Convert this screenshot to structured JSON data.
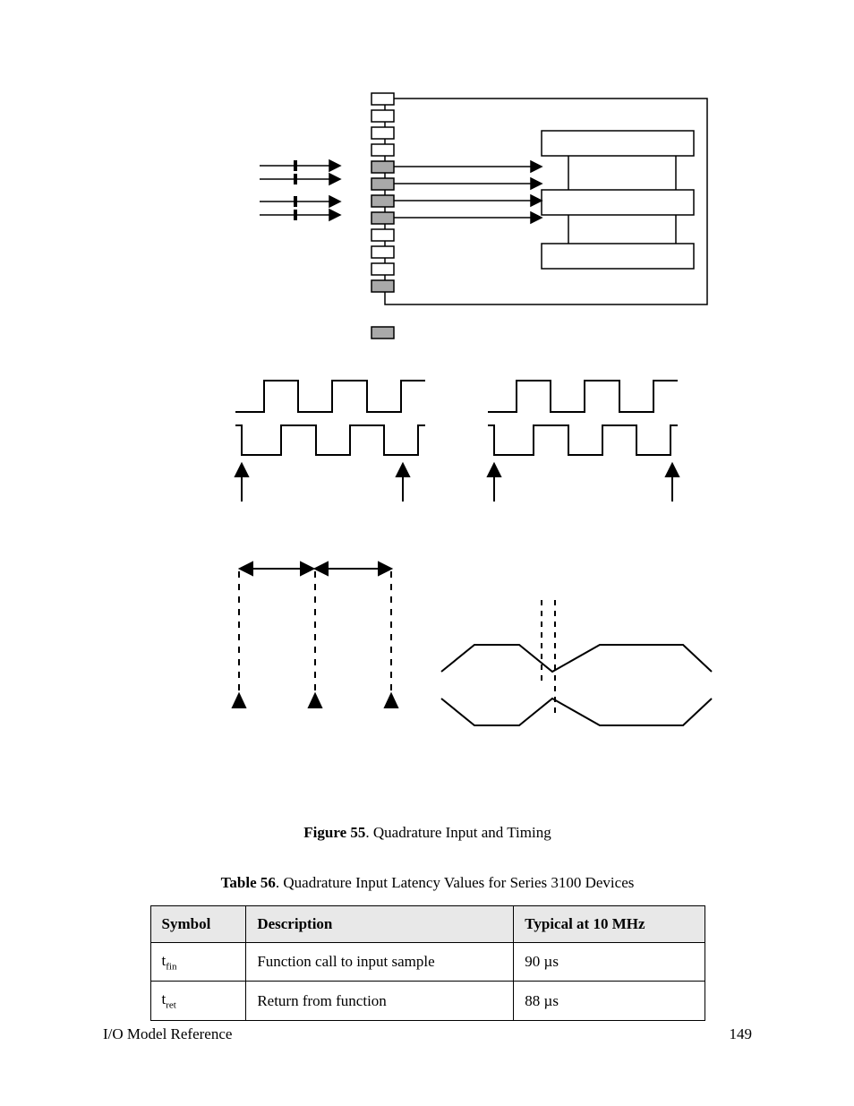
{
  "figure": {
    "label": "Figure 55",
    "caption": ". Quadrature Input and Timing"
  },
  "table": {
    "label": "Table 56",
    "caption": ". Quadrature Input Latency Values for Series 3100 Devices",
    "headers": {
      "c1": "Symbol",
      "c2": "Description",
      "c3": "Typical at 10 MHz"
    },
    "rows": [
      {
        "symbol_base": "t",
        "symbol_sub": "fin",
        "desc": "Function call to input sample",
        "val": "90 µs"
      },
      {
        "symbol_base": "t",
        "symbol_sub": "ret",
        "desc": "Return from function",
        "val": "88 µs"
      }
    ]
  },
  "footer": {
    "left": "I/O Model Reference",
    "page": "149"
  }
}
